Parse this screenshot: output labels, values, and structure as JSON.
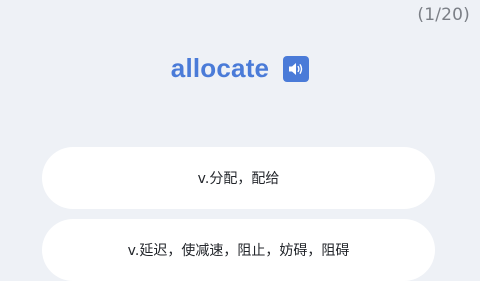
{
  "progress": "(1/20)",
  "word": "allocate",
  "icons": {
    "speaker": "speaker-icon"
  },
  "colors": {
    "accent": "#4a7bd8",
    "background": "#eef1f6",
    "card": "#ffffff",
    "progress_text": "#7b7f86"
  },
  "options": [
    {
      "label": "v.分配，配给"
    },
    {
      "label": "v.延迟，使减速，阻止，妨碍，阻碍"
    }
  ]
}
